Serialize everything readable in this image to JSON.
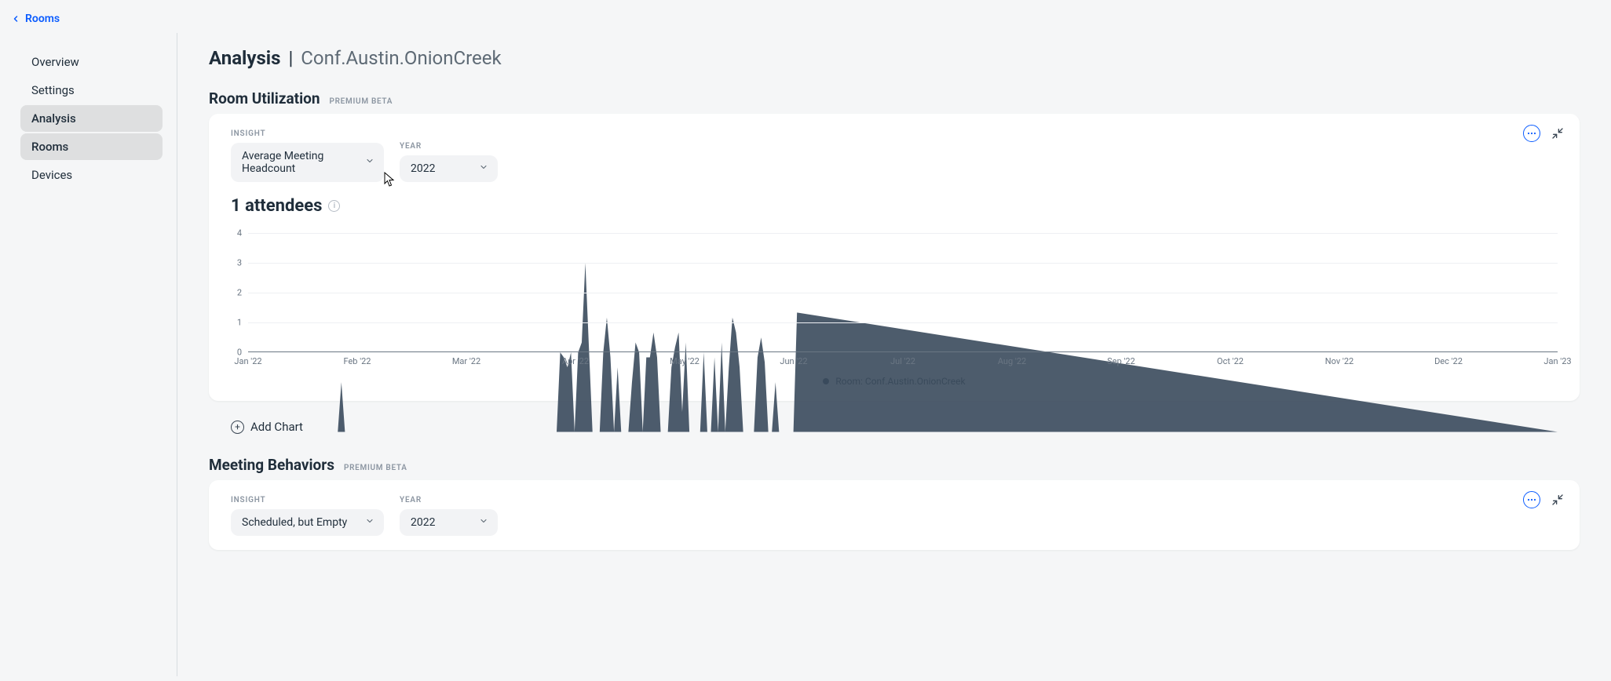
{
  "breadcrumb": {
    "back_label": "Rooms"
  },
  "sidebar": {
    "items": [
      {
        "label": "Overview"
      },
      {
        "label": "Settings"
      },
      {
        "label": "Analysis"
      },
      {
        "label": "Rooms"
      },
      {
        "label": "Devices"
      }
    ]
  },
  "page": {
    "title_prefix": "Analysis",
    "separator": "|",
    "room_name": "Conf.Austin.OnionCreek"
  },
  "section_util": {
    "title": "Room Utilization",
    "badge": "PREMIUM BETA",
    "insight_label": "INSIGHT",
    "year_label": "YEAR",
    "insight": "Average Meeting Headcount",
    "year": "2022",
    "metric": "1 attendees",
    "legend_label": "Room: Conf.Austin.OnionCreek",
    "add_chart_label": "Add Chart"
  },
  "section_beh": {
    "title": "Meeting Behaviors",
    "badge": "PREMIUM BETA",
    "insight_label": "INSIGHT",
    "year_label": "YEAR",
    "insight": "Scheduled, but Empty",
    "year": "2022"
  },
  "chart_data": {
    "type": "area",
    "title": "Average Meeting Headcount",
    "xlabel": "",
    "ylabel": "",
    "ylim": [
      0,
      4
    ],
    "y_ticks": [
      0,
      1,
      2,
      3,
      4
    ],
    "x_tick_labels": [
      "Jan '22",
      "Feb '22",
      "Mar '22",
      "Apr '22",
      "May '22",
      "Jun '22",
      "Jul '22",
      "Aug '22",
      "Sep '22",
      "Oct '22",
      "Nov '22",
      "Dec '22",
      "Jan '23"
    ],
    "series": [
      {
        "name": "Room: Conf.Austin.OnionCreek",
        "color": "#3a4a5c",
        "x": [
          0,
          5,
          25,
          26,
          27,
          28,
          86,
          87,
          88,
          89,
          90,
          91,
          92,
          93,
          94,
          95,
          96,
          97,
          98,
          99,
          100,
          101,
          102,
          103,
          104,
          105,
          106,
          107,
          108,
          109,
          110,
          111,
          112,
          113,
          114,
          115,
          116,
          117,
          118,
          119,
          120,
          121,
          122,
          123,
          124,
          125,
          126,
          127,
          128,
          129,
          130,
          131,
          132,
          133,
          134,
          135,
          136,
          137,
          138,
          139,
          140,
          141,
          142,
          143,
          144,
          145,
          146,
          147,
          148,
          149,
          150,
          151,
          152,
          153,
          365
        ],
        "values": [
          0,
          0,
          0,
          1.0,
          0,
          0,
          0,
          1.6,
          1.5,
          1.3,
          1.6,
          0,
          1.6,
          1.8,
          3.4,
          1.7,
          0,
          0,
          0,
          1.6,
          2.3,
          1.5,
          0,
          1.3,
          0,
          0,
          0,
          1.0,
          1.8,
          1.6,
          0,
          1.5,
          1.5,
          2.0,
          1.5,
          0,
          0,
          0,
          1.3,
          1.7,
          2.0,
          0.4,
          1.8,
          0,
          0,
          0,
          0,
          1.6,
          0,
          0,
          1.5,
          0,
          1.8,
          0,
          1.3,
          2.3,
          2.0,
          1.3,
          0,
          0,
          0,
          0,
          1.5,
          1.9,
          1.4,
          0,
          0,
          1.0,
          0,
          0,
          0,
          0,
          0,
          2.4,
          0
        ]
      }
    ]
  }
}
